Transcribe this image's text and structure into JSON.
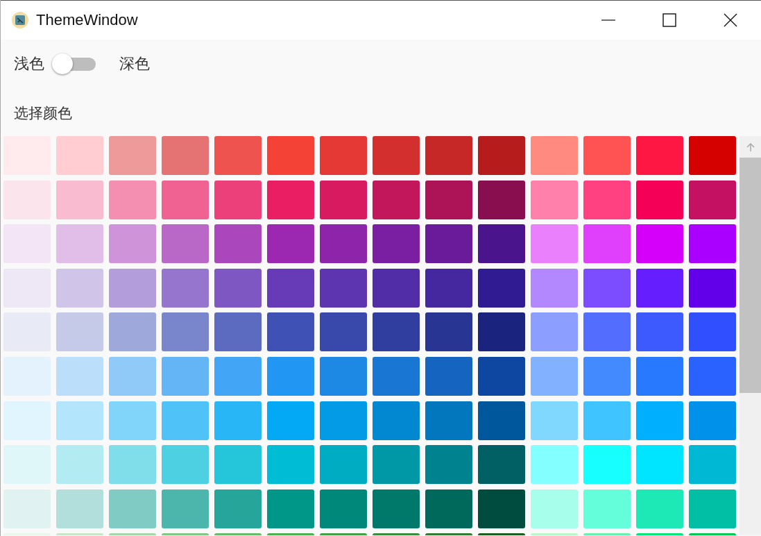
{
  "window": {
    "title": "ThemeWindow"
  },
  "theme_switch": {
    "left_label": "浅色",
    "right_label": "深色",
    "on": false
  },
  "section_title": "选择颜色",
  "swatch_rows": [
    [
      {
        "color": "#ffebee"
      },
      {
        "color": "#ffcdd2"
      },
      {
        "color": "#ef9a9a"
      },
      {
        "color": "#e57373"
      },
      {
        "color": "#ef5350"
      },
      {
        "color": "#f44336"
      },
      {
        "color": "#e53935"
      },
      {
        "color": "#d32f2f"
      },
      {
        "color": "#c62828"
      },
      {
        "color": "#b71c1c"
      },
      {
        "color": "#ff8a80"
      },
      {
        "color": "#ff5252"
      },
      {
        "color": "#ff1744"
      },
      {
        "color": "#d50000"
      }
    ],
    [
      {
        "color": "#fce4ec"
      },
      {
        "color": "#f8bbd0"
      },
      {
        "color": "#f48fb1"
      },
      {
        "color": "#f06292"
      },
      {
        "color": "#ec407a"
      },
      {
        "color": "#e91e63"
      },
      {
        "color": "#d81b60"
      },
      {
        "color": "#c2185b"
      },
      {
        "color": "#ad1457"
      },
      {
        "color": "#880e4f"
      },
      {
        "color": "#ff80ab"
      },
      {
        "color": "#ff4081"
      },
      {
        "color": "#f50057"
      },
      {
        "color": "#c51162"
      }
    ],
    [
      {
        "color": "#f3e5f5"
      },
      {
        "color": "#e1bee7"
      },
      {
        "color": "#ce93d8"
      },
      {
        "color": "#ba68c8"
      },
      {
        "color": "#ab47bc"
      },
      {
        "color": "#9c27b0"
      },
      {
        "color": "#8e24aa"
      },
      {
        "color": "#7b1fa2"
      },
      {
        "color": "#6a1b9a"
      },
      {
        "color": "#4a148c"
      },
      {
        "color": "#ea80fc"
      },
      {
        "color": "#e040fb"
      },
      {
        "color": "#d500f9"
      },
      {
        "color": "#aa00ff"
      }
    ],
    [
      {
        "color": "#ede7f6"
      },
      {
        "color": "#d1c4e9"
      },
      {
        "color": "#b39ddb"
      },
      {
        "color": "#9575cd"
      },
      {
        "color": "#7e57c2"
      },
      {
        "color": "#673ab7"
      },
      {
        "color": "#5e35b1"
      },
      {
        "color": "#512da8"
      },
      {
        "color": "#4527a0"
      },
      {
        "color": "#311b92"
      },
      {
        "color": "#b388ff"
      },
      {
        "color": "#7c4dff"
      },
      {
        "color": "#651fff"
      },
      {
        "color": "#6200ea"
      }
    ],
    [
      {
        "color": "#e8eaf6"
      },
      {
        "color": "#c5cae9"
      },
      {
        "color": "#9fa8da"
      },
      {
        "color": "#7986cb"
      },
      {
        "color": "#5c6bc0"
      },
      {
        "color": "#3f51b5"
      },
      {
        "color": "#3949ab"
      },
      {
        "color": "#303f9f"
      },
      {
        "color": "#283593"
      },
      {
        "color": "#1a237e"
      },
      {
        "color": "#8c9eff"
      },
      {
        "color": "#536dfe"
      },
      {
        "color": "#3d5afe"
      },
      {
        "color": "#304ffe"
      }
    ],
    [
      {
        "color": "#e3f2fd"
      },
      {
        "color": "#bbdefb"
      },
      {
        "color": "#90caf9"
      },
      {
        "color": "#64b5f6"
      },
      {
        "color": "#42a5f5"
      },
      {
        "color": "#2196f3"
      },
      {
        "color": "#1e88e5"
      },
      {
        "color": "#1976d2"
      },
      {
        "color": "#1565c0"
      },
      {
        "color": "#0d47a1"
      },
      {
        "color": "#82b1ff"
      },
      {
        "color": "#448aff"
      },
      {
        "color": "#2979ff"
      },
      {
        "color": "#2962ff"
      }
    ],
    [
      {
        "color": "#e1f5fe"
      },
      {
        "color": "#b3e5fc"
      },
      {
        "color": "#81d4fa"
      },
      {
        "color": "#4fc3f7"
      },
      {
        "color": "#29b6f6"
      },
      {
        "color": "#03a9f4"
      },
      {
        "color": "#039be5"
      },
      {
        "color": "#0288d1"
      },
      {
        "color": "#0277bd"
      },
      {
        "color": "#01579b"
      },
      {
        "color": "#80d8ff"
      },
      {
        "color": "#40c4ff"
      },
      {
        "color": "#00b0ff"
      },
      {
        "color": "#0091ea"
      }
    ],
    [
      {
        "color": "#e0f7fa"
      },
      {
        "color": "#b2ebf2"
      },
      {
        "color": "#80deea"
      },
      {
        "color": "#4dd0e1"
      },
      {
        "color": "#26c6da"
      },
      {
        "color": "#00bcd4"
      },
      {
        "color": "#00acc1"
      },
      {
        "color": "#0097a7"
      },
      {
        "color": "#00838f"
      },
      {
        "color": "#006064"
      },
      {
        "color": "#84ffff"
      },
      {
        "color": "#18ffff"
      },
      {
        "color": "#00e5ff"
      },
      {
        "color": "#00b8d4"
      }
    ],
    [
      {
        "color": "#e0f2f1"
      },
      {
        "color": "#b2dfdb"
      },
      {
        "color": "#80cbc4"
      },
      {
        "color": "#4db6ac"
      },
      {
        "color": "#26a69a"
      },
      {
        "color": "#009688"
      },
      {
        "color": "#00897b"
      },
      {
        "color": "#00796b"
      },
      {
        "color": "#00695c"
      },
      {
        "color": "#004d40"
      },
      {
        "color": "#a7ffeb"
      },
      {
        "color": "#64ffda"
      },
      {
        "color": "#1de9b6"
      },
      {
        "color": "#00bfa5"
      }
    ],
    [
      {
        "color": "#e8f5e9"
      },
      {
        "color": "#c8e6c9"
      },
      {
        "color": "#a5d6a7"
      },
      {
        "color": "#81c784"
      },
      {
        "color": "#66bb6a"
      },
      {
        "color": "#4caf50"
      },
      {
        "color": "#43a047"
      },
      {
        "color": "#388e3c"
      },
      {
        "color": "#2e7d32"
      },
      {
        "color": "#1b5e20"
      },
      {
        "color": "#b9f6ca"
      },
      {
        "color": "#69f0ae"
      },
      {
        "color": "#00e676"
      },
      {
        "color": "#00c853"
      }
    ]
  ]
}
